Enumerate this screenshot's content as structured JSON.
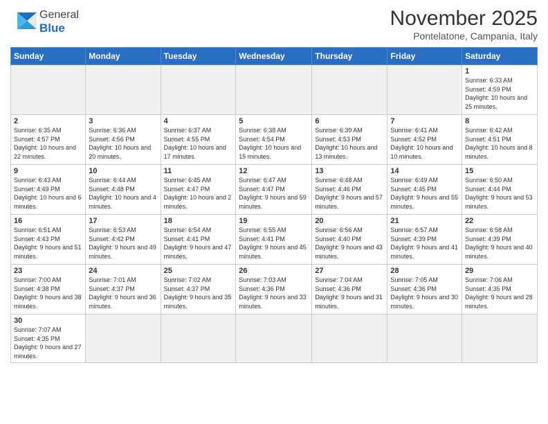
{
  "logo": {
    "general": "General",
    "blue": "Blue"
  },
  "header": {
    "month": "November 2025",
    "location": "Pontelatone, Campania, Italy"
  },
  "days": [
    "Sunday",
    "Monday",
    "Tuesday",
    "Wednesday",
    "Thursday",
    "Friday",
    "Saturday"
  ],
  "weeks": [
    [
      {
        "day": "",
        "info": ""
      },
      {
        "day": "",
        "info": ""
      },
      {
        "day": "",
        "info": ""
      },
      {
        "day": "",
        "info": ""
      },
      {
        "day": "",
        "info": ""
      },
      {
        "day": "",
        "info": ""
      },
      {
        "day": "1",
        "info": "Sunrise: 6:33 AM\nSunset: 4:59 PM\nDaylight: 10 hours and 25 minutes."
      }
    ],
    [
      {
        "day": "2",
        "info": "Sunrise: 6:35 AM\nSunset: 4:57 PM\nDaylight: 10 hours and 22 minutes."
      },
      {
        "day": "3",
        "info": "Sunrise: 6:36 AM\nSunset: 4:56 PM\nDaylight: 10 hours and 20 minutes."
      },
      {
        "day": "4",
        "info": "Sunrise: 6:37 AM\nSunset: 4:55 PM\nDaylight: 10 hours and 17 minutes."
      },
      {
        "day": "5",
        "info": "Sunrise: 6:38 AM\nSunset: 4:54 PM\nDaylight: 10 hours and 15 minutes."
      },
      {
        "day": "6",
        "info": "Sunrise: 6:39 AM\nSunset: 4:53 PM\nDaylight: 10 hours and 13 minutes."
      },
      {
        "day": "7",
        "info": "Sunrise: 6:41 AM\nSunset: 4:52 PM\nDaylight: 10 hours and 10 minutes."
      },
      {
        "day": "8",
        "info": "Sunrise: 6:42 AM\nSunset: 4:51 PM\nDaylight: 10 hours and 8 minutes."
      }
    ],
    [
      {
        "day": "9",
        "info": "Sunrise: 6:43 AM\nSunset: 4:49 PM\nDaylight: 10 hours and 6 minutes."
      },
      {
        "day": "10",
        "info": "Sunrise: 6:44 AM\nSunset: 4:48 PM\nDaylight: 10 hours and 4 minutes."
      },
      {
        "day": "11",
        "info": "Sunrise: 6:45 AM\nSunset: 4:47 PM\nDaylight: 10 hours and 2 minutes."
      },
      {
        "day": "12",
        "info": "Sunrise: 6:47 AM\nSunset: 4:47 PM\nDaylight: 9 hours and 59 minutes."
      },
      {
        "day": "13",
        "info": "Sunrise: 6:48 AM\nSunset: 4:46 PM\nDaylight: 9 hours and 57 minutes."
      },
      {
        "day": "14",
        "info": "Sunrise: 6:49 AM\nSunset: 4:45 PM\nDaylight: 9 hours and 55 minutes."
      },
      {
        "day": "15",
        "info": "Sunrise: 6:50 AM\nSunset: 4:44 PM\nDaylight: 9 hours and 53 minutes."
      }
    ],
    [
      {
        "day": "16",
        "info": "Sunrise: 6:51 AM\nSunset: 4:43 PM\nDaylight: 9 hours and 51 minutes."
      },
      {
        "day": "17",
        "info": "Sunrise: 6:53 AM\nSunset: 4:42 PM\nDaylight: 9 hours and 49 minutes."
      },
      {
        "day": "18",
        "info": "Sunrise: 6:54 AM\nSunset: 4:41 PM\nDaylight: 9 hours and 47 minutes."
      },
      {
        "day": "19",
        "info": "Sunrise: 6:55 AM\nSunset: 4:41 PM\nDaylight: 9 hours and 45 minutes."
      },
      {
        "day": "20",
        "info": "Sunrise: 6:56 AM\nSunset: 4:40 PM\nDaylight: 9 hours and 43 minutes."
      },
      {
        "day": "21",
        "info": "Sunrise: 6:57 AM\nSunset: 4:39 PM\nDaylight: 9 hours and 41 minutes."
      },
      {
        "day": "22",
        "info": "Sunrise: 6:58 AM\nSunset: 4:39 PM\nDaylight: 9 hours and 40 minutes."
      }
    ],
    [
      {
        "day": "23",
        "info": "Sunrise: 7:00 AM\nSunset: 4:38 PM\nDaylight: 9 hours and 38 minutes."
      },
      {
        "day": "24",
        "info": "Sunrise: 7:01 AM\nSunset: 4:37 PM\nDaylight: 9 hours and 36 minutes."
      },
      {
        "day": "25",
        "info": "Sunrise: 7:02 AM\nSunset: 4:37 PM\nDaylight: 9 hours and 35 minutes."
      },
      {
        "day": "26",
        "info": "Sunrise: 7:03 AM\nSunset: 4:36 PM\nDaylight: 9 hours and 33 minutes."
      },
      {
        "day": "27",
        "info": "Sunrise: 7:04 AM\nSunset: 4:36 PM\nDaylight: 9 hours and 31 minutes."
      },
      {
        "day": "28",
        "info": "Sunrise: 7:05 AM\nSunset: 4:36 PM\nDaylight: 9 hours and 30 minutes."
      },
      {
        "day": "29",
        "info": "Sunrise: 7:06 AM\nSunset: 4:35 PM\nDaylight: 9 hours and 28 minutes."
      }
    ],
    [
      {
        "day": "30",
        "info": "Sunrise: 7:07 AM\nSunset: 4:35 PM\nDaylight: 9 hours and 27 minutes."
      },
      {
        "day": "",
        "info": ""
      },
      {
        "day": "",
        "info": ""
      },
      {
        "day": "",
        "info": ""
      },
      {
        "day": "",
        "info": ""
      },
      {
        "day": "",
        "info": ""
      },
      {
        "day": "",
        "info": ""
      }
    ]
  ]
}
